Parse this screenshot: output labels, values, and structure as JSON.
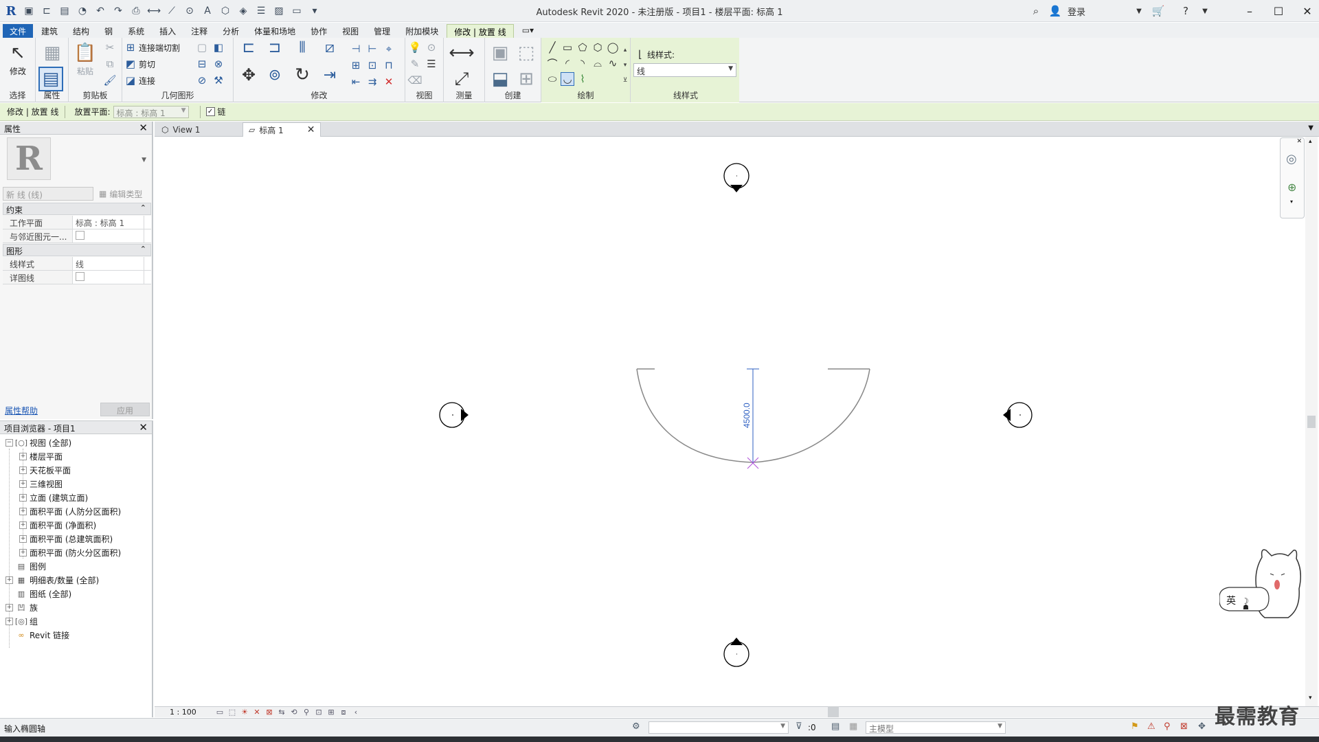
{
  "window": {
    "title": "Autodesk Revit 2020 - 未注册版 - 项目1 - 楼层平面: 标高 1",
    "login_label": "登录"
  },
  "ribbon_tabs": [
    "文件",
    "建筑",
    "结构",
    "钢",
    "系统",
    "插入",
    "注释",
    "分析",
    "体量和场地",
    "协作",
    "视图",
    "管理",
    "附加模块",
    "修改 | 放置 线"
  ],
  "ribbon": {
    "modify_label": "修改",
    "paste_label": "粘贴",
    "cut_geometry_label": "连接端切割",
    "cut_label": "剪切",
    "join_label": "连接",
    "linestyle_label": "线样式:",
    "linestyle_value": "线",
    "groups": {
      "select": "选择",
      "properties": "属性",
      "clipboard": "剪贴板",
      "geometry": "几何图形",
      "modify": "修改",
      "view": "视图",
      "measure": "测量",
      "create": "创建",
      "draw": "绘制",
      "linestyle": "线样式"
    }
  },
  "options_bar": {
    "context": "修改 | 放置 线",
    "placement_label": "放置平面:",
    "placement_value": "标高 : 标高 1",
    "chain_label": "链",
    "chain_checked": true
  },
  "properties": {
    "title": "属性",
    "type_selector": "新 线 (线)",
    "edit_type": "编辑类型",
    "sections": [
      {
        "name": "约束",
        "rows": [
          {
            "key": "工作平面",
            "value": "标高 : 标高 1"
          },
          {
            "key": "与邻近图元一...",
            "value": ""
          }
        ]
      },
      {
        "name": "图形",
        "rows": [
          {
            "key": "线样式",
            "value": "线"
          },
          {
            "key": "详图线",
            "value": ""
          }
        ]
      }
    ],
    "help_link": "属性帮助",
    "apply": "应用"
  },
  "project_browser": {
    "title": "项目浏览器 - 项目1",
    "items": [
      {
        "label": "视图 (全部)",
        "level": 0,
        "expanded": true,
        "icon": "views-icon"
      },
      {
        "label": "楼层平面",
        "level": 1
      },
      {
        "label": "天花板平面",
        "level": 1
      },
      {
        "label": "三维视图",
        "level": 1
      },
      {
        "label": "立面 (建筑立面)",
        "level": 1
      },
      {
        "label": "面积平面 (人防分区面积)",
        "level": 1
      },
      {
        "label": "面积平面 (净面积)",
        "level": 1
      },
      {
        "label": "面积平面 (总建筑面积)",
        "level": 1
      },
      {
        "label": "面积平面 (防火分区面积)",
        "level": 1
      },
      {
        "label": "图例",
        "level": 0,
        "icon": "legend-icon"
      },
      {
        "label": "明细表/数量 (全部)",
        "level": 0,
        "icon": "schedule-icon"
      },
      {
        "label": "图纸 (全部)",
        "level": 0,
        "icon": "sheet-icon"
      },
      {
        "label": "族",
        "level": 0,
        "icon": "family-icon"
      },
      {
        "label": "组",
        "level": 0,
        "icon": "group-icon"
      },
      {
        "label": "Revit 链接",
        "level": 0,
        "icon": "link-icon"
      }
    ]
  },
  "view_tabs": [
    {
      "label": "View 1",
      "active": false
    },
    {
      "label": "标高 1",
      "active": true
    }
  ],
  "canvas": {
    "dimension_text": "4500.0"
  },
  "view_control": {
    "scale": "1 : 100"
  },
  "status_bar": {
    "message": "输入椭圆轴",
    "selection_count": ":0",
    "model_combo": "主模型"
  },
  "watermark": "最需教育",
  "ime": {
    "label": "英"
  }
}
